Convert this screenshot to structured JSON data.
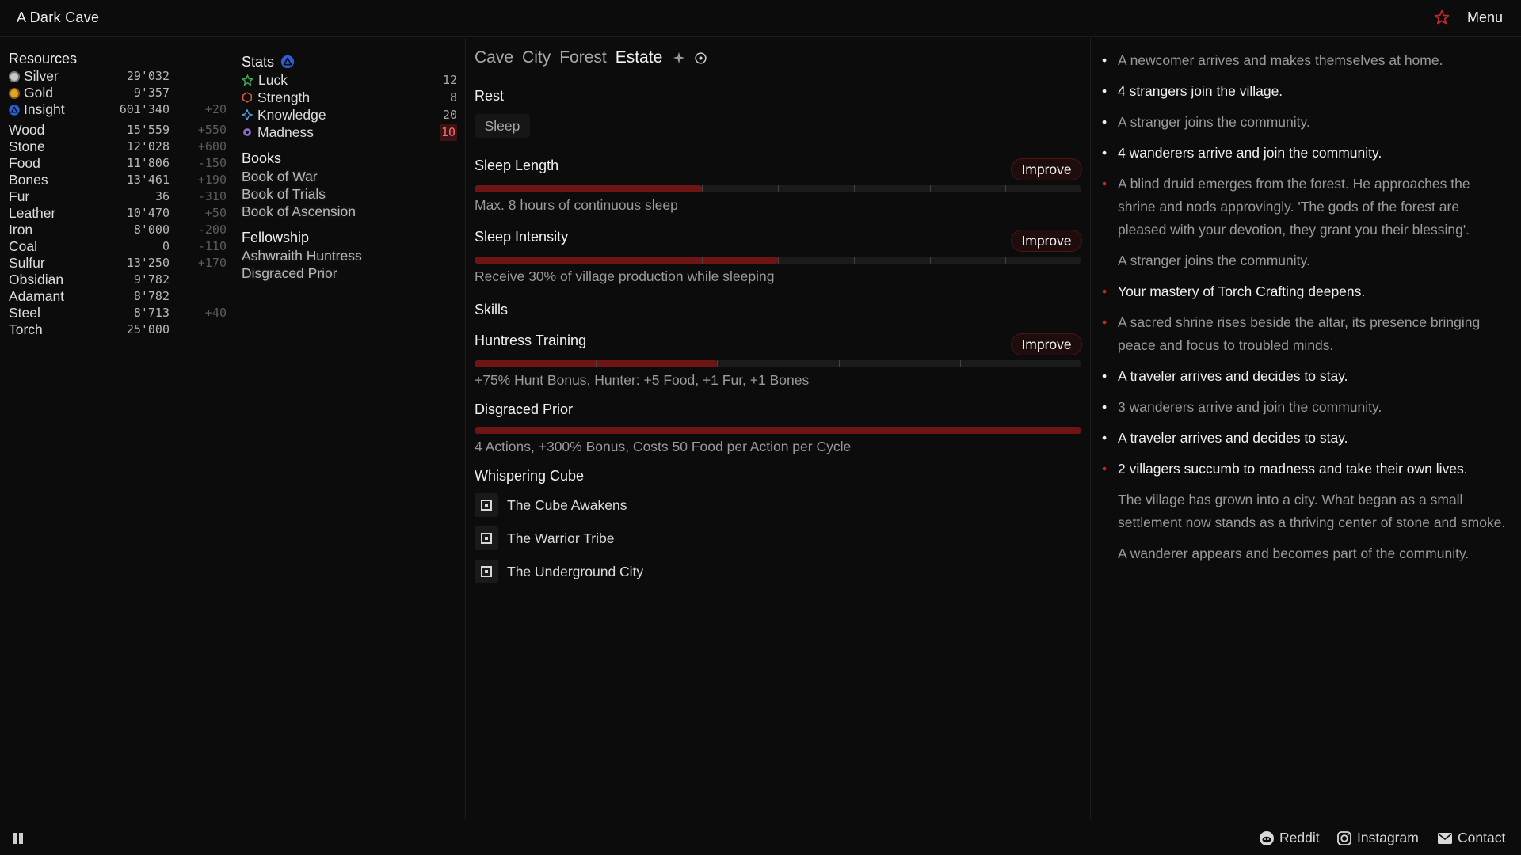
{
  "app": {
    "title": "A Dark Cave",
    "menu_label": "Menu"
  },
  "colors": {
    "accent": "#c8282a",
    "bar_fill": "#6e1414",
    "bg": "#0c0c0c"
  },
  "resources": {
    "title": "Resources",
    "currencies": [
      {
        "name": "Silver",
        "value": "29'032",
        "rate": "",
        "icon": "silver-coin-icon"
      },
      {
        "name": "Gold",
        "value": "9'357",
        "rate": "",
        "icon": "gold-coin-icon"
      },
      {
        "name": "Insight",
        "value": "601'340",
        "rate": "+20",
        "icon": "insight-icon"
      }
    ],
    "materials": [
      {
        "name": "Wood",
        "value": "15'559",
        "rate": "+550"
      },
      {
        "name": "Stone",
        "value": "12'028",
        "rate": "+600"
      },
      {
        "name": "Food",
        "value": "11'806",
        "rate": "-150"
      },
      {
        "name": "Bones",
        "value": "13'461",
        "rate": "+190"
      },
      {
        "name": "Fur",
        "value": "36",
        "rate": "-310"
      },
      {
        "name": "Leather",
        "value": "10'470",
        "rate": "+50"
      },
      {
        "name": "Iron",
        "value": "8'000",
        "rate": "-200"
      },
      {
        "name": "Coal",
        "value": "0",
        "rate": "-110"
      },
      {
        "name": "Sulfur",
        "value": "13'250",
        "rate": "+170"
      },
      {
        "name": "Obsidian",
        "value": "9'782",
        "rate": ""
      },
      {
        "name": "Adamant",
        "value": "8'782",
        "rate": ""
      },
      {
        "name": "Steel",
        "value": "8'713",
        "rate": "+40"
      },
      {
        "name": "Torch",
        "value": "25'000",
        "rate": ""
      }
    ]
  },
  "stats": {
    "title": "Stats",
    "items": [
      {
        "name": "Luck",
        "value": "12",
        "icon": "luck-star-icon"
      },
      {
        "name": "Strength",
        "value": "8",
        "icon": "strength-hexagon-icon"
      },
      {
        "name": "Knowledge",
        "value": "20",
        "icon": "knowledge-diamond-icon"
      },
      {
        "name": "Madness",
        "value": "10",
        "icon": "madness-icon"
      }
    ]
  },
  "books": {
    "title": "Books",
    "items": [
      "Book of War",
      "Book of Trials",
      "Book of Ascension"
    ]
  },
  "fellowship": {
    "title": "Fellowship",
    "items": [
      "Ashwraith Huntress",
      "Disgraced Prior"
    ]
  },
  "tabs": [
    {
      "label": "Cave",
      "active": false
    },
    {
      "label": "City",
      "active": false
    },
    {
      "label": "Forest",
      "active": false
    },
    {
      "label": "Estate",
      "active": true
    }
  ],
  "estate": {
    "rest_title": "Rest",
    "sleep_button": "Sleep",
    "improve_label": "Improve",
    "sleep_length": {
      "title": "Sleep Length",
      "progress": 0.375,
      "segments": 8,
      "desc": "Max. 8 hours of continuous sleep"
    },
    "sleep_intensity": {
      "title": "Sleep Intensity",
      "progress": 0.5,
      "segments": 8,
      "desc": "Receive 30% of village production while sleeping"
    },
    "skills_title": "Skills",
    "huntress_training": {
      "title": "Huntress Training",
      "progress": 0.4,
      "segments": 5,
      "desc": "+75% Hunt Bonus, Hunter: +5 Food, +1 Fur, +1 Bones"
    },
    "disgraced_prior": {
      "title": "Disgraced Prior",
      "progress": 1.0,
      "segments": 1,
      "desc": "4 Actions, +300% Bonus, Costs 50 Food per Action per Cycle"
    },
    "cube_title": "Whispering Cube",
    "cube_items": [
      "The Cube Awakens",
      "The Warrior Tribe",
      "The Underground City"
    ]
  },
  "log": [
    {
      "text": "A newcomer arrives and makes themselves at home.",
      "bullet": "white",
      "tone": "dim"
    },
    {
      "text": "4 strangers join the village.",
      "bullet": "white",
      "tone": "bright"
    },
    {
      "text": "A stranger joins the community.",
      "bullet": "white",
      "tone": "dim"
    },
    {
      "text": "4 wanderers arrive and join the community.",
      "bullet": "white",
      "tone": "bright"
    },
    {
      "text": "A blind druid emerges from the forest. He approaches the shrine and nods approvingly. 'The gods of the forest are pleased with your devotion, they grant you their blessing'.",
      "bullet": "red",
      "tone": "dim"
    },
    {
      "text": "A stranger joins the community.",
      "bullet": "none",
      "tone": "dim"
    },
    {
      "text": "Your mastery of Torch Crafting deepens.",
      "bullet": "red",
      "tone": "bright"
    },
    {
      "text": "A sacred shrine rises beside the altar, its presence bringing peace and focus to troubled minds.",
      "bullet": "red",
      "tone": "dim"
    },
    {
      "text": "A traveler arrives and decides to stay.",
      "bullet": "white",
      "tone": "bright"
    },
    {
      "text": "3 wanderers arrive and join the community.",
      "bullet": "white",
      "tone": "dim"
    },
    {
      "text": "A traveler arrives and decides to stay.",
      "bullet": "white",
      "tone": "bright"
    },
    {
      "text": "2 villagers succumb to madness and take their own lives.",
      "bullet": "red",
      "tone": "bright"
    },
    {
      "text": "The village has grown into a city. What began as a small settlement now stands as a thriving center of stone and smoke.",
      "bullet": "none",
      "tone": "dim"
    },
    {
      "text": "A wanderer appears and becomes part of the community.",
      "bullet": "none",
      "tone": "dim"
    }
  ],
  "footer": {
    "reddit": "Reddit",
    "instagram": "Instagram",
    "contact": "Contact"
  }
}
